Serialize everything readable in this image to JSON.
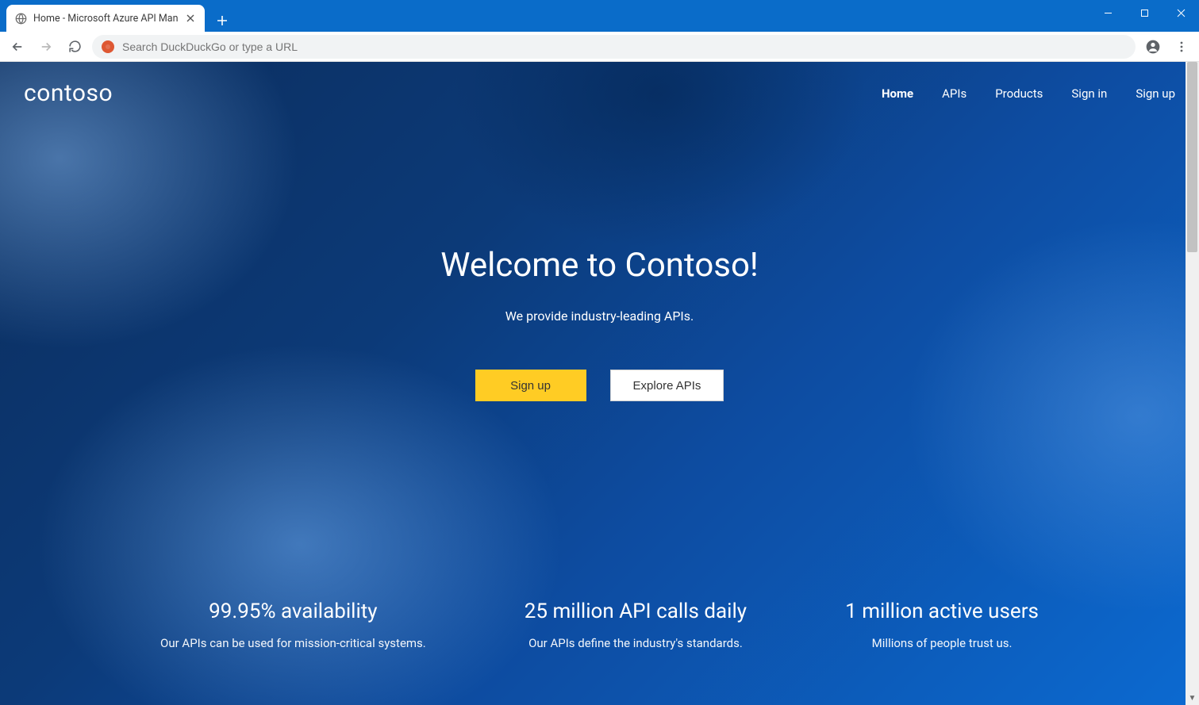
{
  "browser": {
    "tab_title": "Home - Microsoft Azure API Man",
    "omnibox_placeholder": "Search DuckDuckGo or type a URL"
  },
  "header": {
    "brand": "contoso",
    "nav": [
      {
        "label": "Home",
        "active": true
      },
      {
        "label": "APIs",
        "active": false
      },
      {
        "label": "Products",
        "active": false
      },
      {
        "label": "Sign in",
        "active": false
      },
      {
        "label": "Sign up",
        "active": false
      }
    ]
  },
  "hero": {
    "title": "Welcome to Contoso!",
    "subtitle": "We provide industry-leading APIs.",
    "primary_cta": "Sign up",
    "secondary_cta": "Explore APIs"
  },
  "stats": [
    {
      "headline": "99.95% availability",
      "sub": "Our APIs can be used for mission-critical systems."
    },
    {
      "headline": "25 million API calls daily",
      "sub": "Our APIs define the industry's standards."
    },
    {
      "headline": "1 million active users",
      "sub": "Millions of people trust us."
    }
  ],
  "colors": {
    "browser_chrome": "#0a6cc9",
    "cta_primary": "#ffcc24"
  }
}
